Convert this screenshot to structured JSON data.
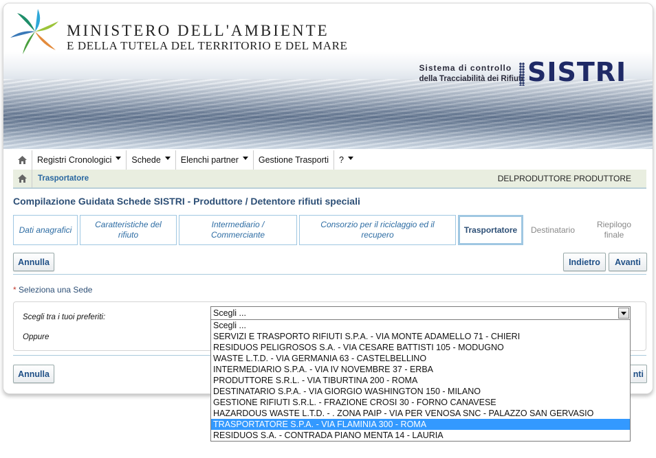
{
  "header": {
    "ministry_line1": "MINISTERO DELL'AMBIENTE",
    "ministry_line2": "E DELLA TUTELA DEL TERRITORIO E DEL MARE",
    "sistri_tag_line1": "Sistema di controllo",
    "sistri_tag_line2": "della Tracciabilità dei Rifiuti",
    "sistri_logo": "SISTRI"
  },
  "menu": {
    "items": [
      {
        "label": "Registri Cronologici",
        "has_caret": true
      },
      {
        "label": "Schede",
        "has_caret": true
      },
      {
        "label": "Elenchi partner",
        "has_caret": true
      },
      {
        "label": "Gestione Trasporti",
        "has_caret": false
      },
      {
        "label": "?",
        "has_caret": true
      }
    ]
  },
  "breadcrumb": {
    "current": "Trasportatore",
    "user": "DELPRODUTTORE PRODUTTORE"
  },
  "page_title": "Compilazione Guidata Schede SISTRI - Produttore / Detentore rifiuti speciali",
  "steps": [
    {
      "label": "Dati anagrafici"
    },
    {
      "label": "Caratteristiche del rifiuto"
    },
    {
      "label": "Intermediario / Commerciante"
    },
    {
      "label": "Consorzio per il riciclaggio ed il recupero"
    },
    {
      "label": "Trasportatore"
    },
    {
      "label": "Destinatario"
    },
    {
      "label": "Riepilogo finale"
    }
  ],
  "buttons": {
    "annulla": "Annulla",
    "indietro": "Indietro",
    "avanti": "Avanti",
    "avanti_partial": "nti"
  },
  "form": {
    "required_mark": "*",
    "select_sede": "Seleziona una Sede",
    "label_preferiti": "Scegli tra i tuoi preferiti:",
    "label_oppure": "Oppure",
    "select_value": "Scegli ...",
    "options": [
      "Scegli ...",
      "SERVIZI E TRASPORTO RIFIUTI S.P.A. - VIA MONTE ADAMELLO 71 - CHIERI",
      "RESIDUOS PELIGROSOS S.A. - VIA CESARE BATTISTI 105 - MODUGNO",
      "WASTE L.T.D. - VIA GERMANIA 63 - CASTELBELLINO",
      "INTERMEDIARIO S.P.A. - VIA IV NOVEMBRE 37 - ERBA",
      "PRODUTTORE S.R.L. - VIA TIBURTINA 200 - ROMA",
      "DESTINATARIO S.P.A. - VIA GIORGIO WASHINGTON 150 - MILANO",
      "GESTIONE RIFIUTI S.R.L. - FRAZIONE CROSI 30 - FORNO CANAVESE",
      "HAZARDOUS WASTE L.T.D. - . ZONA PAIP - VIA PER VENOSA SNC - PALAZZO SAN GERVASIO",
      "TRASPORTATORE S.P.A. - VIA FLAMINIA 300 - ROMA",
      "RESIDUOS S.A. - CONTRADA PIANO MENTA 14 - LAURIA"
    ],
    "highlighted_index": 9
  },
  "colors": {
    "accent_blue": "#2866a0",
    "step_border": "#9fc7e2",
    "dropdown_highlight": "#3399ff",
    "sistri_brand": "#1f2a66"
  },
  "icons": {
    "menu_home": "home-icon",
    "crumb_home": "home-icon",
    "select_arrow": "chevron-down-icon"
  }
}
